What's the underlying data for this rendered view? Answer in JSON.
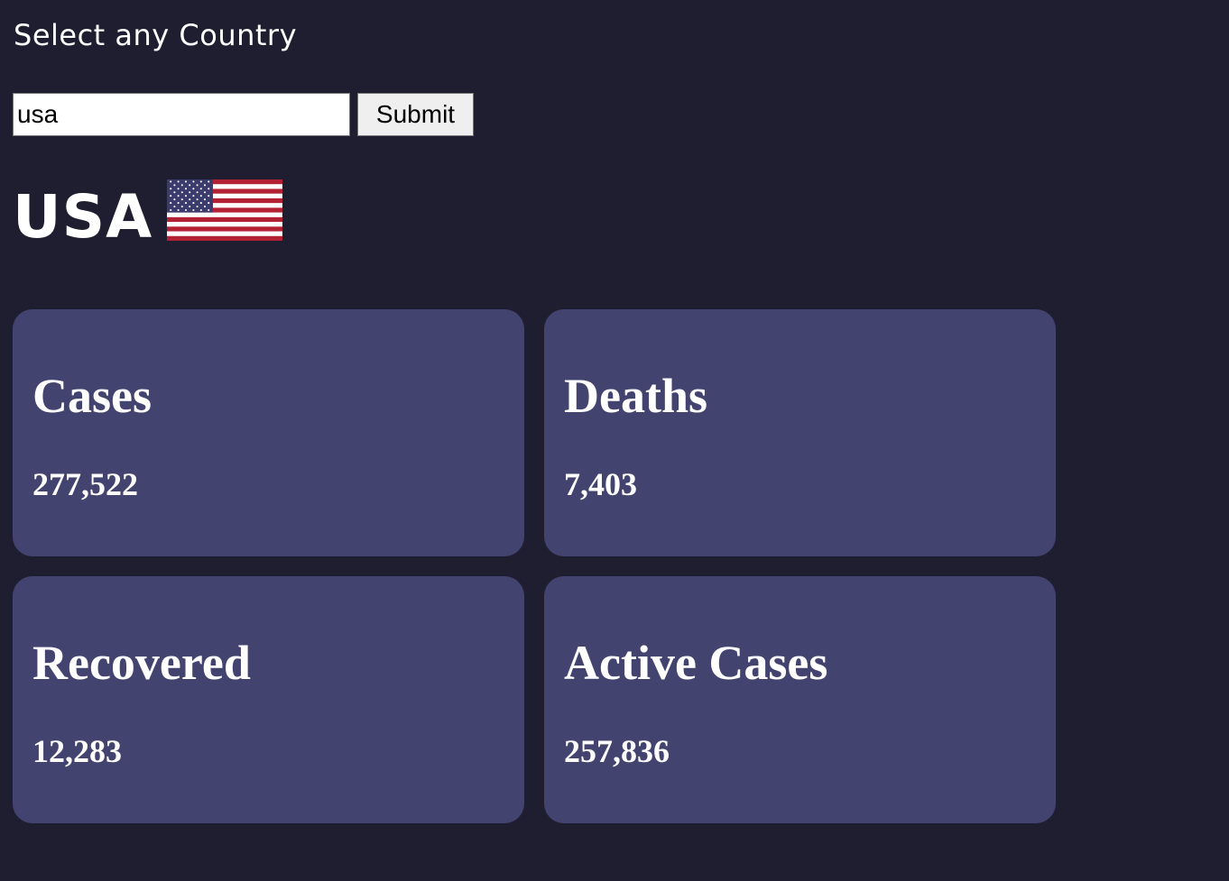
{
  "prompt": "Select any Country",
  "search": {
    "value": "usa",
    "submit_label": "Submit"
  },
  "country": {
    "name": "USA",
    "flag_icon": "us-flag-icon"
  },
  "stats": [
    {
      "title": "Cases",
      "value": "277,522"
    },
    {
      "title": "Deaths",
      "value": "7,403"
    },
    {
      "title": "Recovered",
      "value": "12,283"
    },
    {
      "title": "Active Cases",
      "value": "257,836"
    }
  ],
  "colors": {
    "background": "#1f1e30",
    "card": "#434370",
    "text": "#ffffff",
    "flag_red": "#b22234",
    "flag_blue": "#3c3b6e"
  }
}
